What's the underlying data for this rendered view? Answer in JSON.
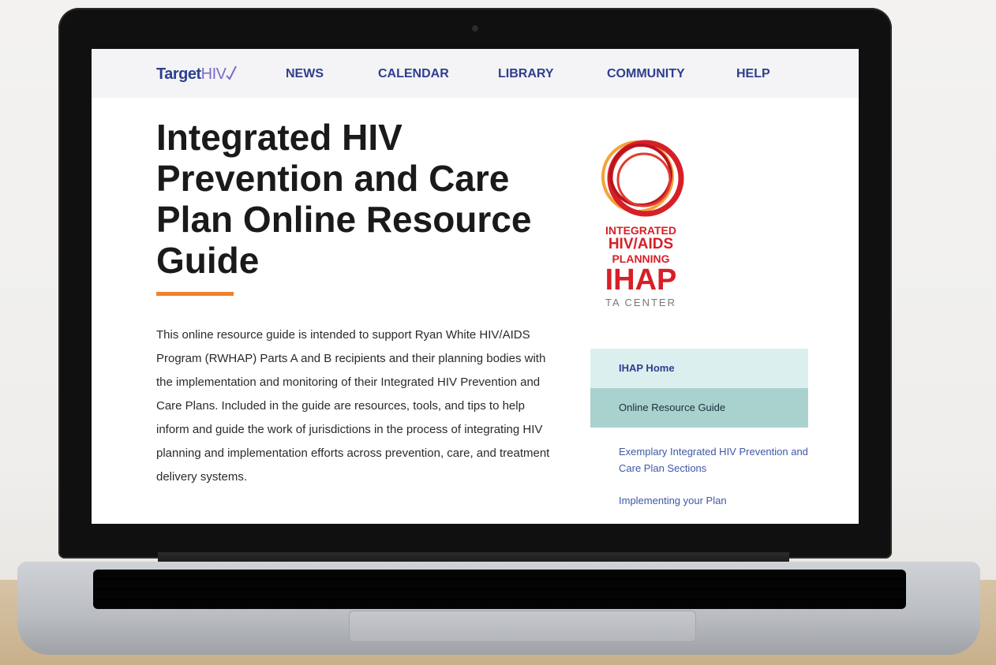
{
  "nav": {
    "logo_main": "Target",
    "logo_accent": "HIV",
    "items": [
      "NEWS",
      "CALENDAR",
      "LIBRARY",
      "COMMUNITY",
      "HELP"
    ]
  },
  "page": {
    "title": "Integrated HIV Prevention and Care Plan Online Resource Guide",
    "intro": "This online resource guide is intended to support Ryan White HIV/AIDS Program (RWHAP) Parts A and B recipients and their planning bodies with the implementation and monitoring of their Integrated HIV Prevention and Care Plans. Included in the guide are resources, tools, and tips to help inform and guide the work of jurisdictions in the process of integrating HIV planning and implementation efforts across prevention, care, and treatment delivery systems."
  },
  "ihap_logo": {
    "line1": "INTEGRATED",
    "line2": "HIV/AIDS",
    "line3": "PLANNING",
    "line4": "IHAP",
    "line5": "TA CENTER"
  },
  "sidebar": {
    "items": [
      {
        "label": "IHAP Home"
      },
      {
        "label": "Online Resource Guide"
      }
    ],
    "links": [
      {
        "label": "Exemplary Integrated HIV Prevention and Care Plan Sections"
      },
      {
        "label": "Implementing your Plan"
      }
    ]
  },
  "colors": {
    "brand_blue": "#2d3f8e",
    "accent_orange": "#f0812e",
    "ihap_red": "#d71f27",
    "ihap_orange": "#f2a33a",
    "sidebar_home_bg": "#dcefef",
    "sidebar_active_bg": "#a9d2cf"
  }
}
